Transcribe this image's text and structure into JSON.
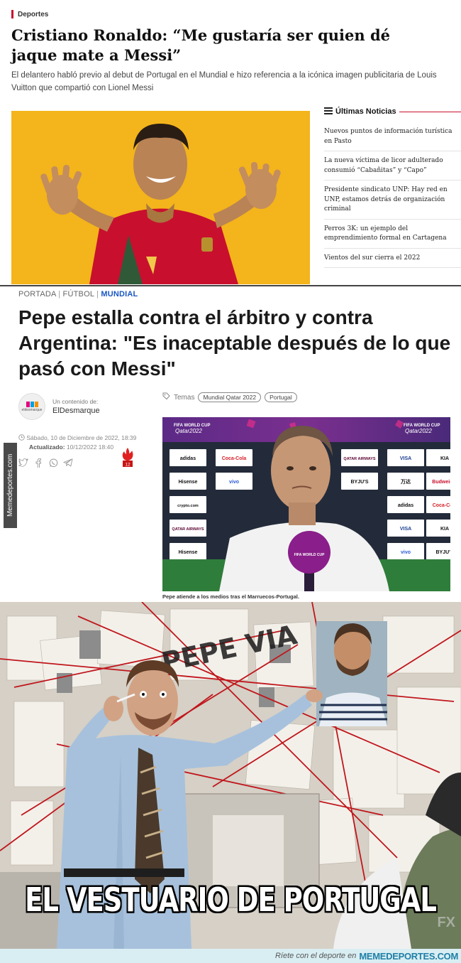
{
  "panel1": {
    "section": "Deportes",
    "headline": "Cristiano Ronaldo: “Me gustaría ser quien dé jaque mate a Messi”",
    "summary": "El delantero habló previo al debut de Portugal en el Mundial e hizo referencia a la icónica imagen publicitaria de Louis Vuitton que compartió con Lionel Messi",
    "sidebar": {
      "title": "Últimas Noticias",
      "items": [
        "Nuevos puntos de información turística en Pasto",
        "La nueva víctima de licor adulterado consumió “Cabañitas” y “Capo”",
        "Presidente sindicato UNP: Hay red en UNP, estamos detrás de organización criminal",
        "Perros 3K: un ejemplo del emprendimiento formal en Cartagena",
        "Vientos del sur cierra el 2022"
      ]
    },
    "photo_colors": {
      "background": "#f4b41b",
      "jersey": "#c8102e"
    }
  },
  "panel2": {
    "breadcrumb": {
      "portada": "PORTADA",
      "futbol": "FÚTBOL",
      "mundial": "MUNDIAL",
      "sep": "|"
    },
    "headline": "Pepe estalla contra el árbitro y contra Argentina: \"Es inaceptable después de lo que pasó con Messi\"",
    "author": {
      "content_label": "Un contenido de:",
      "name": "ElDesmarque",
      "logo_text": "eldesmarque"
    },
    "tags": {
      "label": "Temas",
      "items": [
        "Mundial Qatar 2022",
        "Portugal"
      ]
    },
    "dates": {
      "published": "Sábado, 10 de Diciembre de 2022, 18:39",
      "updated_label": "Actualizado:",
      "updated": "10/12/2022 18:40"
    },
    "hot_count": "12",
    "photo_caption": "Pepe atiende a los medios tras el Marruecos-Portugal.",
    "photo_board": {
      "wc_label": "FIFA WORLD CUP",
      "wc_sub": "Qatar2022",
      "mic_label": "FIFA WORLD CUP",
      "sponsors": [
        "adidas",
        "Coca-Cola",
        "QATAR AIRWAYS",
        "VISA",
        "KIA",
        "Hisense",
        "vivo",
        "BYJU'S",
        "万达",
        "Budweiser",
        "crypto.com"
      ]
    },
    "watermark": "Memedeportes.com"
  },
  "panel3": {
    "caption": "EL VESTUARIO DE PORTUGAL",
    "wall_text": "PEPE VIA",
    "tv_mark": "FX"
  },
  "footer": {
    "text": "Ríete con el deporte en",
    "site": "MEMEDEPORTES.COM"
  }
}
